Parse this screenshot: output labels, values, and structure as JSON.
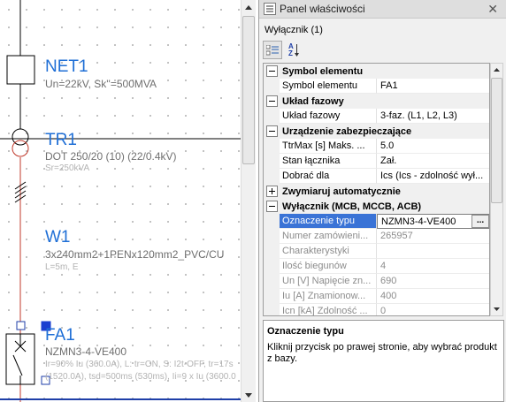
{
  "canvas": {
    "net": {
      "name": "NET1",
      "params": "Un=22kV, Sk''=500MVA"
    },
    "transformer": {
      "name": "TR1",
      "params": "DOT 250/20 (10) (22/0.4kV)",
      "rating": "Sr=250kVA"
    },
    "cable": {
      "name": "W1",
      "params": "3x240mm2+1PENx120mm2_PVC/CU",
      "length": "L=5m, E"
    },
    "breaker": {
      "name": "FA1",
      "type": "NZMN3-4-VE400",
      "settings1": "Ir=90% Iu (360.0A), L: tr=ON, S: I2t-OFF, tr=17s",
      "settings2": "(1520.0A), tsd=500ms (530ms), Ii=9 x Iu (3600.0"
    },
    "line_color": "#c0392b",
    "accent": "#1f6fd6"
  },
  "panel": {
    "title": "Panel właściwości",
    "title_icon": "properties-icon",
    "close_glyph": "✕",
    "selection": "Wyłącznik (1)",
    "toolbar": {
      "categorized_icon": "categorized-icon",
      "sort_icon": "sort-az-icon",
      "sort_label": "AZ"
    },
    "rows": [
      {
        "kind": "cat",
        "expanded": true,
        "label": "Symbol elementu"
      },
      {
        "kind": "prop",
        "name": "Symbol elementu",
        "value": "FA1"
      },
      {
        "kind": "cat",
        "expanded": true,
        "label": "Układ fazowy"
      },
      {
        "kind": "prop",
        "name": "Układ fazowy",
        "value": "3-faz. (L1, L2, L3)"
      },
      {
        "kind": "cat",
        "expanded": true,
        "label": "Urządzenie zabezpieczające"
      },
      {
        "kind": "prop",
        "name": "TtrMax [s] Maks. ...",
        "value": "5.0"
      },
      {
        "kind": "prop",
        "name": "Stan łącznika",
        "value": "Zał."
      },
      {
        "kind": "prop",
        "name": "Dobrać dla",
        "value": "Ics (Ics - zdolność wył..."
      },
      {
        "kind": "cat",
        "expanded": false,
        "label": "Zwymiaruj automatycznie"
      },
      {
        "kind": "cat",
        "expanded": true,
        "label": "Wyłącznik (MCB, MCCB, ACB)"
      },
      {
        "kind": "prop",
        "name": "Oznaczenie typu",
        "value": "NZMN3-4-VE400",
        "selected": true,
        "browse": "..."
      },
      {
        "kind": "prop",
        "name": "Numer zamówieni...",
        "value": "265957",
        "readonly": true
      },
      {
        "kind": "prop",
        "name": "Charakterystyki",
        "value": "",
        "readonly": true
      },
      {
        "kind": "prop",
        "name": "Ilość biegunów",
        "value": "4",
        "readonly": true
      },
      {
        "kind": "prop",
        "name": "Un [V] Napięcie zn...",
        "value": "690",
        "readonly": true
      },
      {
        "kind": "prop",
        "name": "Iu [A] Znamionow...",
        "value": "400",
        "readonly": true
      },
      {
        "kind": "prop",
        "name": "Icn [kA] Zdolność ...",
        "value": "0",
        "readonly": true
      }
    ],
    "description": {
      "title": "Oznaczenie typu",
      "text": "Kliknij przycisk po prawej stronie, aby wybrać produkt z bazy."
    }
  }
}
